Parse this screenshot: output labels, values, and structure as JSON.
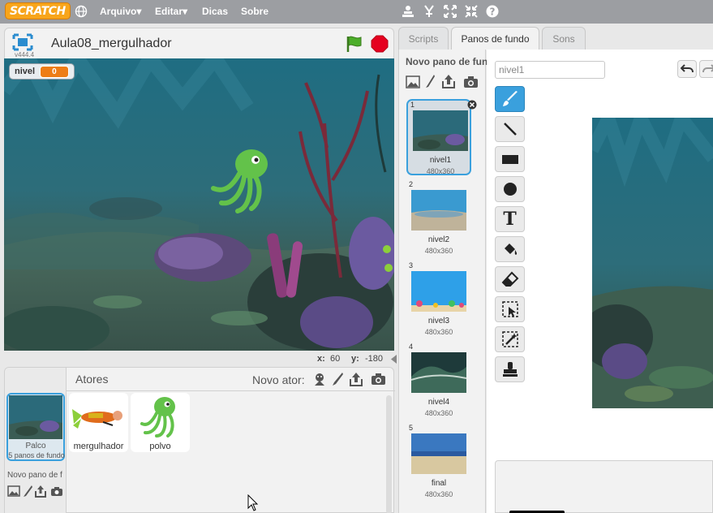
{
  "topbar": {
    "logo": "SCRATCH",
    "menu": [
      "Arquivo",
      "Editar",
      "Dicas",
      "Sobre"
    ],
    "arrow": "▾"
  },
  "stage": {
    "title": "Aula08_mergulhador",
    "version": "v444.4",
    "variable": {
      "name": "nivel",
      "value": "0"
    },
    "coords": {
      "x_label": "x:",
      "x_value": "60",
      "y_label": "y:",
      "y_value": "-180"
    }
  },
  "sprites": {
    "header": "Atores",
    "new_sprite_label": "Novo ator:",
    "stage_thumb": {
      "name": "Palco",
      "subtitle": "5 panos de fundo"
    },
    "new_backdrop_label": "Novo pano de f",
    "items": [
      {
        "name": "mergulhador"
      },
      {
        "name": "polvo"
      }
    ]
  },
  "tabs": [
    {
      "label": "Scripts"
    },
    {
      "label": "Panos de fundo"
    },
    {
      "label": "Sons"
    }
  ],
  "backdrops": {
    "new_label": "Novo pano de fundo",
    "items": [
      {
        "num": "1",
        "name": "nivel1",
        "size": "480x360"
      },
      {
        "num": "2",
        "name": "nivel2",
        "size": "480x360"
      },
      {
        "num": "3",
        "name": "nivel3",
        "size": "480x360"
      },
      {
        "num": "4",
        "name": "nivel4",
        "size": "480x360"
      },
      {
        "num": "5",
        "name": "final",
        "size": "480x360"
      }
    ]
  },
  "editor": {
    "costume_name_value": "nivel1",
    "tools": [
      "brush-icon",
      "line-icon",
      "rectangle-icon",
      "ellipse-icon",
      "text-icon",
      "fill-icon",
      "eraser-icon",
      "select-icon",
      "magic-select-icon",
      "stamp-icon"
    ],
    "text_tool_glyph": "T"
  },
  "colors": {
    "accent": "#3aa0dd",
    "orange": "#ee7d16",
    "topbar": "#9c9ea2"
  }
}
